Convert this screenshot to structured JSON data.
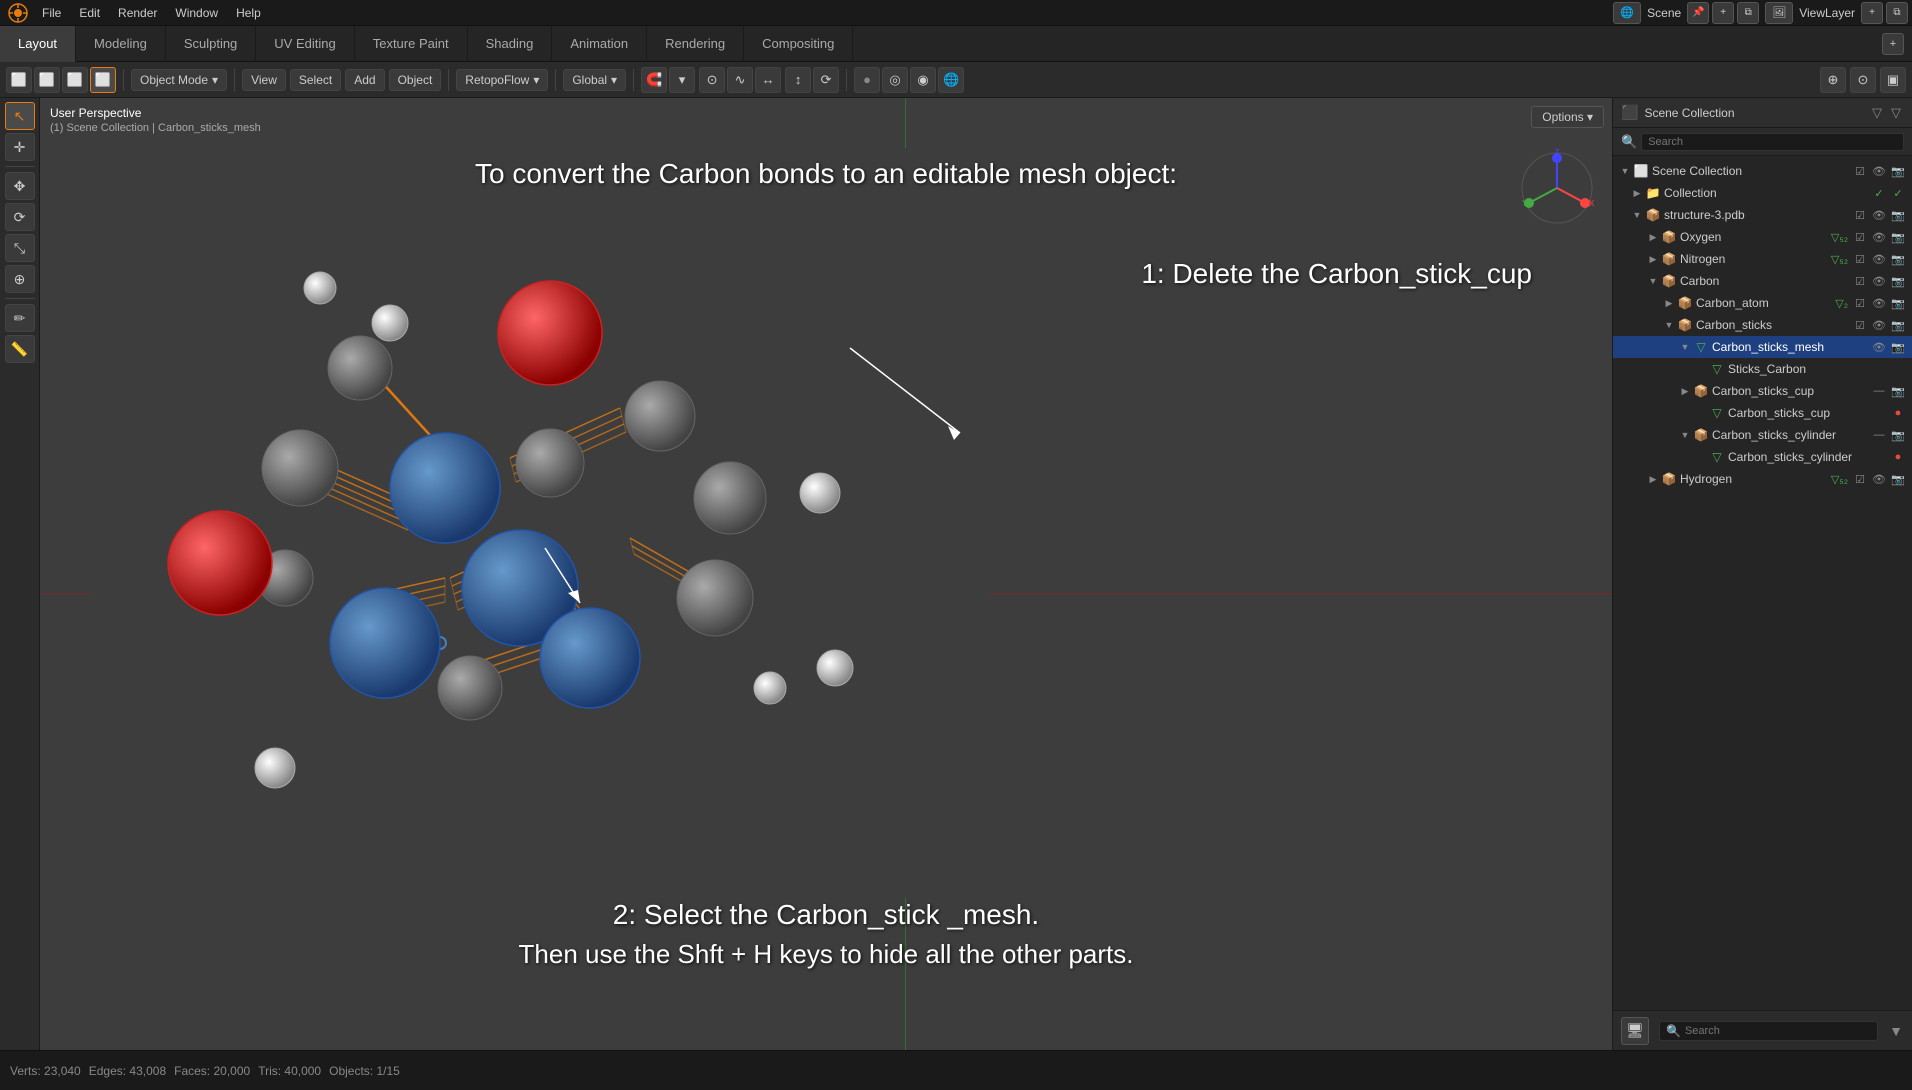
{
  "app": {
    "logo": "🔶",
    "menus": [
      "File",
      "Edit",
      "Render",
      "Window",
      "Help"
    ],
    "title": "Scene",
    "view_layer": "ViewLayer"
  },
  "workspace_tabs": [
    {
      "label": "Layout",
      "active": true
    },
    {
      "label": "Modeling",
      "active": false
    },
    {
      "label": "Sculpting",
      "active": false
    },
    {
      "label": "UV Editing",
      "active": false
    },
    {
      "label": "Texture Paint",
      "active": false
    },
    {
      "label": "Shading",
      "active": false
    },
    {
      "label": "Animation",
      "active": false
    },
    {
      "label": "Rendering",
      "active": false
    },
    {
      "label": "Compositing",
      "active": false
    }
  ],
  "toolbar": {
    "object_mode": "Object Mode",
    "view_label": "View",
    "select_label": "Select",
    "add_label": "Add",
    "object_label": "Object",
    "retopoflow": "RetopoFlow",
    "global": "Global",
    "options_label": "Options ▾",
    "search_placeholder": "Search"
  },
  "viewport": {
    "perspective_label": "User Perspective",
    "breadcrumb": "(1) Scene Collection | Carbon_sticks_mesh",
    "instruction_title": "To convert the Carbon bonds to an editable mesh object:",
    "step1": "1: Delete the Carbon_stick_cup",
    "step2_line1": "2: Select the Carbon_stick _mesh.",
    "step2_line2": "Then use the Shft + H keys to hide all the other parts."
  },
  "outliner": {
    "title": "Scene Collection",
    "search_placeholder": "Search",
    "search_label": "Search",
    "items": [
      {
        "id": "collection",
        "label": "Collection",
        "indent": 1,
        "icon": "📁",
        "type": "collection",
        "has_expand": true,
        "expanded": false
      },
      {
        "id": "structure-3",
        "label": "structure-3.pdb",
        "indent": 1,
        "icon": "📦",
        "type": "object",
        "has_expand": true,
        "expanded": true
      },
      {
        "id": "oxygen",
        "label": "Oxygen",
        "indent": 2,
        "icon": "📦",
        "type": "collection",
        "has_expand": true,
        "expanded": false,
        "tag": "V5 2"
      },
      {
        "id": "nitrogen",
        "label": "Nitrogen",
        "indent": 2,
        "icon": "📦",
        "type": "collection",
        "has_expand": true,
        "expanded": false,
        "tag": "V5 2"
      },
      {
        "id": "carbon",
        "label": "Carbon",
        "indent": 2,
        "icon": "📦",
        "type": "collection",
        "has_expand": true,
        "expanded": true
      },
      {
        "id": "carbon_atom",
        "label": "Carbon_atom",
        "indent": 3,
        "icon": "📦",
        "type": "object",
        "has_expand": true,
        "expanded": false,
        "tag": "2"
      },
      {
        "id": "carbon_sticks",
        "label": "Carbon_sticks",
        "indent": 3,
        "icon": "📦",
        "type": "object",
        "has_expand": true,
        "expanded": true
      },
      {
        "id": "carbon_sticks_mesh",
        "label": "Carbon_sticks_mesh",
        "indent": 4,
        "icon": "▽",
        "type": "mesh",
        "has_expand": true,
        "expanded": true,
        "selected": true
      },
      {
        "id": "sticks_carbon",
        "label": "Sticks_Carbon",
        "indent": 5,
        "icon": "▽",
        "type": "mesh_data",
        "has_expand": false,
        "expanded": false
      },
      {
        "id": "carbon_sticks_cup_group",
        "label": "Carbon_sticks_cup",
        "indent": 4,
        "icon": "📦",
        "type": "collection",
        "has_expand": true,
        "expanded": false
      },
      {
        "id": "carbon_sticks_cup",
        "label": "Carbon_sticks_cup",
        "indent": 5,
        "icon": "▽",
        "type": "mesh",
        "has_expand": false,
        "expanded": false,
        "dot": "red"
      },
      {
        "id": "carbon_sticks_cylinder_group",
        "label": "Carbon_sticks_cylinder",
        "indent": 4,
        "icon": "📦",
        "type": "collection",
        "has_expand": true,
        "expanded": false
      },
      {
        "id": "carbon_sticks_cylinder",
        "label": "Carbon_sticks_cylinder",
        "indent": 5,
        "icon": "▽",
        "type": "mesh",
        "has_expand": false,
        "expanded": false,
        "dot": "red"
      },
      {
        "id": "hydrogen",
        "label": "Hydrogen",
        "indent": 2,
        "icon": "📦",
        "type": "collection",
        "has_expand": true,
        "expanded": false,
        "tag": "V5 2"
      }
    ]
  },
  "status_bar": {
    "vertices": "Verts: 23,040",
    "edges": "Edges: 43,008",
    "faces": "Faces: 20,000",
    "triangles": "Tris: 40,000",
    "objects": "Objects: 1/15"
  },
  "icons": {
    "expand": "▶",
    "collapse": "▼",
    "eye": "👁",
    "camera": "📷",
    "restrict": "☰",
    "checkbox": "☑",
    "search": "🔍",
    "filter": "▼"
  }
}
